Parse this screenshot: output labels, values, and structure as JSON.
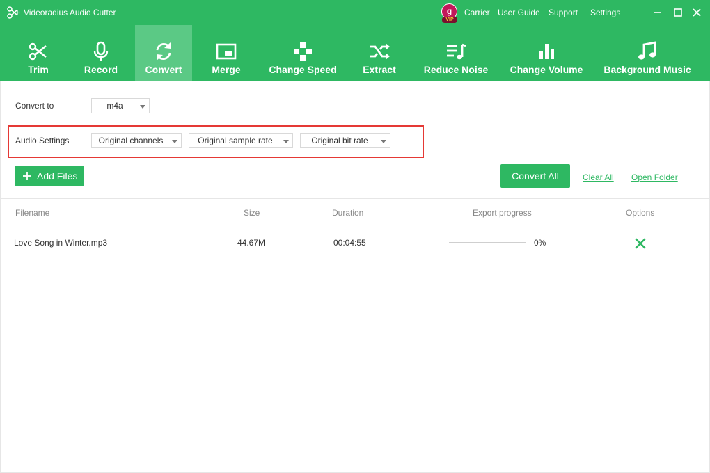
{
  "window": {
    "title": "Videoradius Audio Cutter",
    "vip_letter": "g",
    "vip_badge": "VIP",
    "links": [
      "Carrier",
      "User Guide",
      "Support",
      "Settings"
    ],
    "brand_color": "#2eb862"
  },
  "toolbar": {
    "items": [
      {
        "label": "Trim",
        "icon": "scissors-icon",
        "active": false
      },
      {
        "label": "Record",
        "icon": "microphone-icon",
        "active": false
      },
      {
        "label": "Convert",
        "icon": "convert-arrows-icon",
        "active": true
      },
      {
        "label": "Merge",
        "icon": "merge-icon",
        "active": false
      },
      {
        "label": "Change Speed",
        "icon": "gamepad-icon",
        "active": false
      },
      {
        "label": "Extract",
        "icon": "shuffle-icon",
        "active": false
      },
      {
        "label": "Reduce Noise",
        "icon": "music-list-icon",
        "active": false
      },
      {
        "label": "Change Volume",
        "icon": "bar-chart-icon",
        "active": false
      },
      {
        "label": "Background Music",
        "icon": "music-note-icon",
        "active": false
      }
    ]
  },
  "convert": {
    "label": "Convert to",
    "format": "m4a"
  },
  "audio_settings": {
    "label": "Audio Settings",
    "channels": "Original channels",
    "sample_rate": "Original sample rate",
    "bit_rate": "Original bit rate"
  },
  "actions": {
    "add_files": "Add Files",
    "convert_all": "Convert All",
    "clear_all": "Clear All",
    "open_folder": "Open Folder"
  },
  "table": {
    "headers": [
      "Filename",
      "Size",
      "Duration",
      "Export progress",
      "Options"
    ],
    "rows": [
      {
        "filename": "Love Song in Winter.mp3",
        "size": "44.67M",
        "duration": "00:04:55",
        "progress_text": "0%",
        "progress": 0
      }
    ]
  }
}
